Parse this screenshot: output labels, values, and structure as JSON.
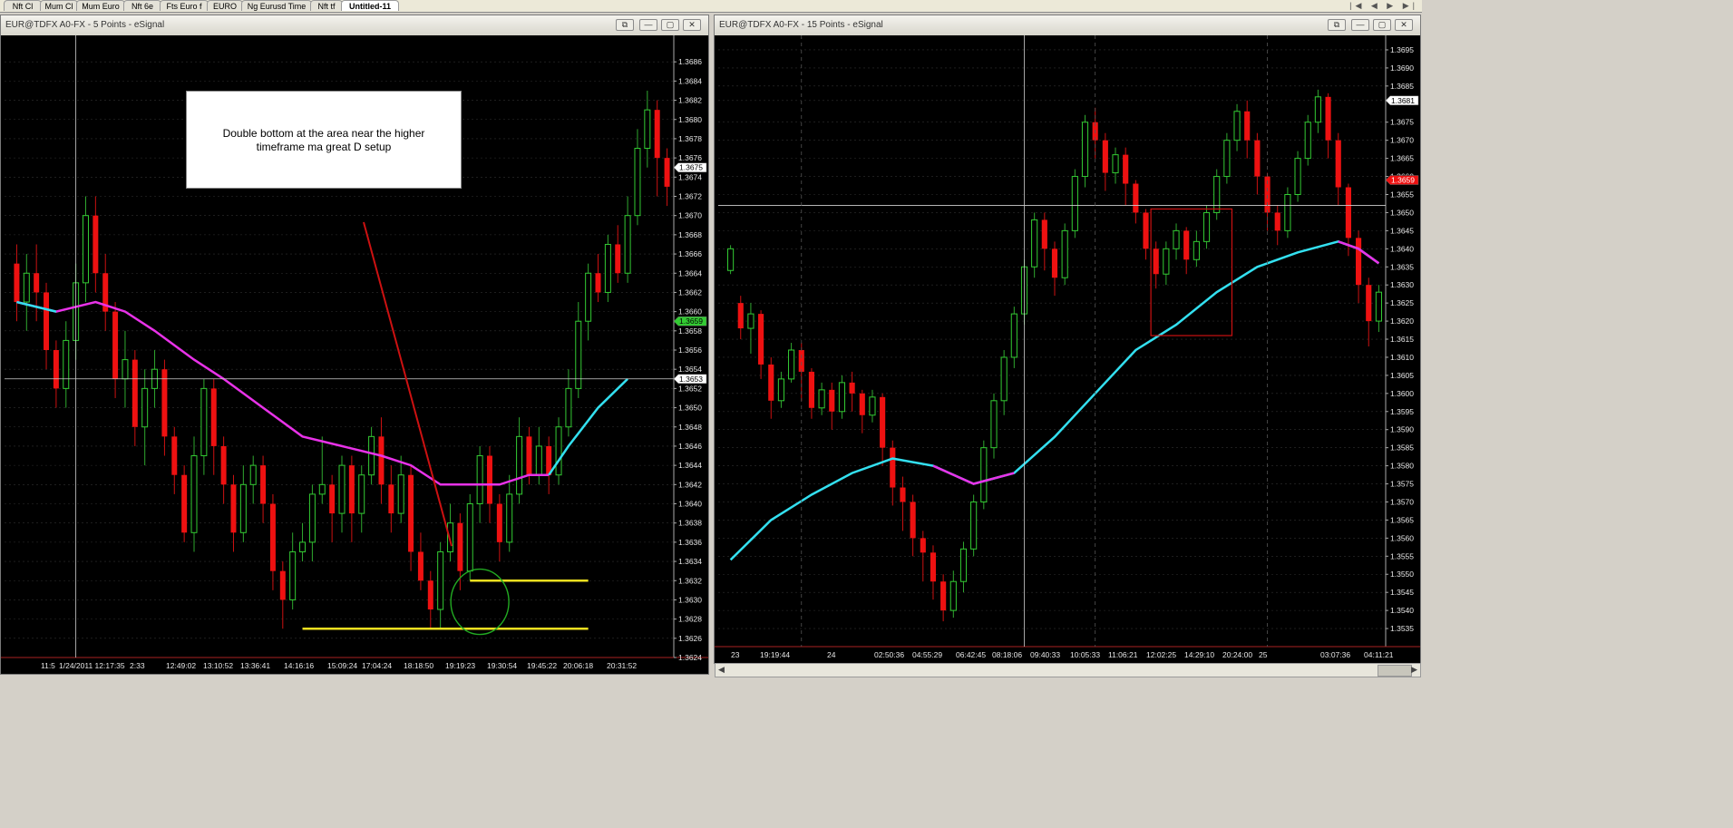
{
  "tabs": [
    {
      "label": "Nft Cl",
      "active": false
    },
    {
      "label": "Mum Cl",
      "active": false
    },
    {
      "label": "Mum Euro",
      "active": false
    },
    {
      "label": "Nft 6e",
      "active": false
    },
    {
      "label": "Fts Euro f",
      "active": false
    },
    {
      "label": "EURO",
      "active": false
    },
    {
      "label": "Ng Eurusd Time",
      "active": false
    },
    {
      "label": "Nft tf",
      "active": false
    },
    {
      "label": "Untitled-11",
      "active": true
    }
  ],
  "nav_arrows": "|◀ ◀ ▶ ▶|",
  "left_window": {
    "title": "EUR@TDFX A0-FX - 5 Points - eSignal",
    "note": "Double bottom at the area near the higher timeframe ma great D setup"
  },
  "right_window": {
    "title": "EUR@TDFX A0-FX - 15 Points - eSignal"
  },
  "chart_data": [
    {
      "type": "candlestick",
      "interval": "5 Points",
      "ylim": [
        1.3624,
        1.3688
      ],
      "y_ticks": [
        "1.3686",
        "1.3684",
        "1.3682",
        "1.3680",
        "1.3678",
        "1.3676",
        "1.3674",
        "1.3672",
        "1.3670",
        "1.3668",
        "1.3666",
        "1.3664",
        "1.3662",
        "1.3660",
        "1.3658",
        "1.3656",
        "1.3654",
        "1.3652",
        "1.3650",
        "1.3648",
        "1.3646",
        "1.3644",
        "1.3642",
        "1.3640",
        "1.3638",
        "1.3636",
        "1.3634",
        "1.3632",
        "1.3630",
        "1.3628",
        "1.3626",
        "1.3624"
      ],
      "x_ticks": [
        "11:5",
        "1/24/2011 12:17:35",
        "2:33",
        "12:49:02",
        "13:10:52",
        "13:36:41",
        "14:16:16",
        "15:09:24",
        "17:04:24",
        "18:18:50",
        "19:19:23",
        "19:30:54",
        "19:45:22",
        "20:06:18",
        "20:31:52"
      ],
      "price_labels": [
        {
          "text": "1.3675",
          "value": 1.3675,
          "bg": "#ffffff",
          "fg": "#000000"
        },
        {
          "text": "1.3659",
          "value": 1.3659,
          "bg": "#33cc33",
          "fg": "#000000"
        },
        {
          "text": "1.3653",
          "value": 1.3653,
          "bg": "#ffffff",
          "fg": "#000000"
        }
      ],
      "crosshair": {
        "price": 1.3653
      },
      "support_lines": [
        1.3632,
        1.3627
      ],
      "ma_colors": {
        "above": "#e832e8",
        "below": "#33e0f0"
      },
      "colors": {
        "up": "#33cc33",
        "down": "#ee1111",
        "neutral": "#c8c8c8"
      },
      "candles": [
        [
          1.3665,
          1.3661,
          1.3667,
          1.3659
        ],
        [
          1.3661,
          1.3664,
          1.3666,
          1.3658
        ],
        [
          1.3664,
          1.3662,
          1.3667,
          1.3659
        ],
        [
          1.3662,
          1.3656,
          1.3663,
          1.3654
        ],
        [
          1.3656,
          1.3652,
          1.3657,
          1.365
        ],
        [
          1.3652,
          1.3657,
          1.3659,
          1.365
        ],
        [
          1.3657,
          1.3663,
          1.3665,
          1.3655
        ],
        [
          1.3663,
          1.367,
          1.3672,
          1.3661
        ],
        [
          1.367,
          1.3664,
          1.3672,
          1.3662
        ],
        [
          1.3664,
          1.366,
          1.3666,
          1.3658
        ],
        [
          1.366,
          1.3653,
          1.3661,
          1.3651
        ],
        [
          1.3653,
          1.3655,
          1.3658,
          1.365
        ],
        [
          1.3655,
          1.3648,
          1.3656,
          1.3646
        ],
        [
          1.3648,
          1.3652,
          1.3654,
          1.3644
        ],
        [
          1.3652,
          1.3654,
          1.3656,
          1.365
        ],
        [
          1.3654,
          1.3647,
          1.3655,
          1.3645
        ],
        [
          1.3647,
          1.3643,
          1.3648,
          1.3641
        ],
        [
          1.3643,
          1.3637,
          1.3644,
          1.3636
        ],
        [
          1.3637,
          1.3645,
          1.3647,
          1.3635
        ],
        [
          1.3645,
          1.3652,
          1.3653,
          1.3643
        ],
        [
          1.3652,
          1.3646,
          1.3653,
          1.3643
        ],
        [
          1.3646,
          1.3642,
          1.3647,
          1.364
        ],
        [
          1.3642,
          1.3637,
          1.3643,
          1.3635
        ],
        [
          1.3637,
          1.3642,
          1.3644,
          1.3636
        ],
        [
          1.3642,
          1.3644,
          1.3645,
          1.364
        ],
        [
          1.3644,
          1.364,
          1.3645,
          1.3638
        ],
        [
          1.364,
          1.3633,
          1.3641,
          1.3631
        ],
        [
          1.3633,
          1.363,
          1.3634,
          1.3627
        ],
        [
          1.363,
          1.3635,
          1.3637,
          1.3629
        ],
        [
          1.3635,
          1.3636,
          1.3638,
          1.3634
        ],
        [
          1.3636,
          1.3641,
          1.3642,
          1.3634
        ],
        [
          1.3641,
          1.3642,
          1.3647,
          1.364
        ],
        [
          1.3642,
          1.3639,
          1.3643,
          1.3636
        ],
        [
          1.3639,
          1.3644,
          1.3645,
          1.3637
        ],
        [
          1.3644,
          1.3639,
          1.3645,
          1.3636
        ],
        [
          1.3639,
          1.3643,
          1.3644,
          1.3637
        ],
        [
          1.3643,
          1.3647,
          1.3648,
          1.3642
        ],
        [
          1.3647,
          1.3642,
          1.3649,
          1.364
        ],
        [
          1.3642,
          1.3639,
          1.3644,
          1.3637
        ],
        [
          1.3639,
          1.3643,
          1.3645,
          1.3638
        ],
        [
          1.3643,
          1.3635,
          1.3644,
          1.3633
        ],
        [
          1.3635,
          1.3632,
          1.3637,
          1.3631
        ],
        [
          1.3632,
          1.3629,
          1.3633,
          1.3627
        ],
        [
          1.3629,
          1.3635,
          1.3636,
          1.3627
        ],
        [
          1.3635,
          1.3638,
          1.364,
          1.3634
        ],
        [
          1.3638,
          1.3633,
          1.3639,
          1.3631
        ],
        [
          1.3633,
          1.364,
          1.3641,
          1.3632
        ],
        [
          1.364,
          1.3645,
          1.3646,
          1.3638
        ],
        [
          1.3645,
          1.364,
          1.3646,
          1.3638
        ],
        [
          1.364,
          1.3636,
          1.3641,
          1.3634
        ],
        [
          1.3636,
          1.3641,
          1.3643,
          1.3635
        ],
        [
          1.3641,
          1.3647,
          1.3649,
          1.364
        ],
        [
          1.3647,
          1.3643,
          1.3648,
          1.3642
        ],
        [
          1.3643,
          1.3646,
          1.3648,
          1.3642
        ],
        [
          1.3646,
          1.3643,
          1.3647,
          1.3641
        ],
        [
          1.3643,
          1.3648,
          1.3649,
          1.3642
        ],
        [
          1.3648,
          1.3652,
          1.3654,
          1.3647
        ],
        [
          1.3652,
          1.3659,
          1.3661,
          1.3651
        ],
        [
          1.3659,
          1.3664,
          1.3665,
          1.3657
        ],
        [
          1.3664,
          1.3662,
          1.3666,
          1.3661
        ],
        [
          1.3662,
          1.3667,
          1.3668,
          1.3661
        ],
        [
          1.3667,
          1.3664,
          1.3669,
          1.3663
        ],
        [
          1.3664,
          1.367,
          1.3672,
          1.3663
        ],
        [
          1.367,
          1.3677,
          1.3679,
          1.3669
        ],
        [
          1.3677,
          1.3681,
          1.3683,
          1.3675
        ],
        [
          1.3681,
          1.3676,
          1.3682,
          1.3672
        ],
        [
          1.3676,
          1.3673,
          1.3677,
          1.3671
        ]
      ],
      "ma": [
        [
          0,
          1.3661
        ],
        [
          4,
          1.366
        ],
        [
          8,
          1.3661
        ],
        [
          11,
          1.366
        ],
        [
          14,
          1.3658
        ],
        [
          18,
          1.3655
        ],
        [
          21,
          1.3653
        ],
        [
          25,
          1.365
        ],
        [
          29,
          1.3647
        ],
        [
          33,
          1.3646
        ],
        [
          37,
          1.3645
        ],
        [
          40,
          1.3644
        ],
        [
          43,
          1.3642
        ],
        [
          46,
          1.3642
        ],
        [
          49,
          1.3642
        ],
        [
          52,
          1.3643
        ],
        [
          54,
          1.3643
        ],
        [
          56,
          1.3646
        ],
        [
          59,
          1.365
        ],
        [
          62,
          1.3653
        ]
      ],
      "ma_switch_index": 53
    },
    {
      "type": "candlestick",
      "interval": "15 Points",
      "ylim": [
        1.353,
        1.3697
      ],
      "y_ticks": [
        "1.3695",
        "1.3690",
        "1.3685",
        "1.3681",
        "1.3675",
        "1.3670",
        "1.3665",
        "1.3660",
        "1.3655",
        "1.3650",
        "1.3645",
        "1.3640",
        "1.3635",
        "1.3630",
        "1.3625",
        "1.3620",
        "1.3615",
        "1.3610",
        "1.3605",
        "1.3600",
        "1.3595",
        "1.3590",
        "1.3585",
        "1.3580",
        "1.3575",
        "1.3570",
        "1.3565",
        "1.3560",
        "1.3555",
        "1.3550",
        "1.3545",
        "1.3540",
        "1.3535"
      ],
      "x_ticks": [
        "23",
        "19:19:44",
        "24",
        "02:50:36",
        "04:55:29",
        "06:42:45",
        "08:18:06",
        "09:40:33",
        "10:05:33",
        "11:06:21",
        "12:02:25",
        "14:29:10",
        "20:24:00",
        "25",
        "03:07:36",
        "04:11:21"
      ],
      "price_labels": [
        {
          "text": "1.3681",
          "value": 1.3681,
          "bg": "#ffffff",
          "fg": "#000000"
        },
        {
          "text": "1.3659",
          "value": 1.3659,
          "bg": "#ee1111",
          "fg": "#ffffff"
        }
      ],
      "crosshair": {
        "price": 1.3652
      },
      "highlight_box": {
        "x0": 42,
        "x1": 49,
        "y_top": 1.3651,
        "y_bottom": 1.3616
      },
      "ma_colors": {
        "above": "#e832e8",
        "below": "#33e0f0"
      },
      "colors": {
        "up": "#33cc33",
        "down": "#ee1111",
        "neutral": "#c8c8c8"
      },
      "candles": [
        [
          1.3634,
          1.364,
          1.3641,
          1.3633
        ],
        [
          1.3625,
          1.3618,
          1.3627,
          1.3615
        ],
        [
          1.3618,
          1.3622,
          1.3625,
          1.3611
        ],
        [
          1.3622,
          1.3608,
          1.3623,
          1.3604
        ],
        [
          1.3608,
          1.3598,
          1.361,
          1.3593
        ],
        [
          1.3598,
          1.3604,
          1.3606,
          1.3596
        ],
        [
          1.3604,
          1.3612,
          1.3614,
          1.3603
        ],
        [
          1.3612,
          1.3606,
          1.3614,
          1.3598
        ],
        [
          1.3606,
          1.3596,
          1.3607,
          1.3593
        ],
        [
          1.3596,
          1.3601,
          1.3603,
          1.3594
        ],
        [
          1.3601,
          1.3595,
          1.3603,
          1.359
        ],
        [
          1.3595,
          1.3603,
          1.3605,
          1.3593
        ],
        [
          1.3603,
          1.36,
          1.3606,
          1.3595
        ],
        [
          1.36,
          1.3594,
          1.3601,
          1.3589
        ],
        [
          1.3594,
          1.3599,
          1.3601,
          1.3592
        ],
        [
          1.3599,
          1.3585,
          1.36,
          1.358
        ],
        [
          1.3585,
          1.3574,
          1.3587,
          1.3569
        ],
        [
          1.3574,
          1.357,
          1.3577,
          1.3562
        ],
        [
          1.357,
          1.356,
          1.3572,
          1.3555
        ],
        [
          1.356,
          1.3556,
          1.3562,
          1.3548
        ],
        [
          1.3556,
          1.3548,
          1.3558,
          1.3543
        ],
        [
          1.3548,
          1.354,
          1.355,
          1.3537
        ],
        [
          1.354,
          1.3548,
          1.3551,
          1.3538
        ],
        [
          1.3548,
          1.3557,
          1.3559,
          1.3545
        ],
        [
          1.3557,
          1.357,
          1.3572,
          1.3555
        ],
        [
          1.357,
          1.3585,
          1.3587,
          1.3568
        ],
        [
          1.3585,
          1.3598,
          1.36,
          1.3582
        ],
        [
          1.3598,
          1.361,
          1.3612,
          1.3594
        ],
        [
          1.361,
          1.3622,
          1.3624,
          1.3607
        ],
        [
          1.3622,
          1.3635,
          1.3637,
          1.3619
        ],
        [
          1.3635,
          1.3648,
          1.365,
          1.3632
        ],
        [
          1.3648,
          1.364,
          1.365,
          1.3634
        ],
        [
          1.364,
          1.3632,
          1.3642,
          1.3627
        ],
        [
          1.3632,
          1.3645,
          1.3647,
          1.363
        ],
        [
          1.3645,
          1.366,
          1.3662,
          1.3643
        ],
        [
          1.366,
          1.3675,
          1.3677,
          1.3657
        ],
        [
          1.3675,
          1.367,
          1.3679,
          1.3665
        ],
        [
          1.367,
          1.3661,
          1.3672,
          1.3656
        ],
        [
          1.3661,
          1.3666,
          1.3668,
          1.3658
        ],
        [
          1.3666,
          1.3658,
          1.3668,
          1.3652
        ],
        [
          1.3658,
          1.365,
          1.3659,
          1.3647
        ],
        [
          1.365,
          1.364,
          1.3651,
          1.3637
        ],
        [
          1.364,
          1.3633,
          1.3642,
          1.3629
        ],
        [
          1.3633,
          1.364,
          1.3642,
          1.363
        ],
        [
          1.364,
          1.3645,
          1.3647,
          1.3637
        ],
        [
          1.3645,
          1.3637,
          1.3646,
          1.3633
        ],
        [
          1.3637,
          1.3642,
          1.3645,
          1.3635
        ],
        [
          1.3642,
          1.365,
          1.3652,
          1.364
        ],
        [
          1.365,
          1.366,
          1.3662,
          1.3648
        ],
        [
          1.366,
          1.367,
          1.3672,
          1.3658
        ],
        [
          1.367,
          1.3678,
          1.368,
          1.3667
        ],
        [
          1.3678,
          1.367,
          1.3681,
          1.3665
        ],
        [
          1.367,
          1.366,
          1.3672,
          1.3655
        ],
        [
          1.366,
          1.365,
          1.3661,
          1.3645
        ],
        [
          1.365,
          1.3645,
          1.3652,
          1.3641
        ],
        [
          1.3645,
          1.3655,
          1.3657,
          1.3643
        ],
        [
          1.3655,
          1.3665,
          1.3667,
          1.3653
        ],
        [
          1.3665,
          1.3675,
          1.3677,
          1.3663
        ],
        [
          1.3675,
          1.3682,
          1.3684,
          1.3672
        ],
        [
          1.3682,
          1.367,
          1.3683,
          1.3665
        ],
        [
          1.367,
          1.3657,
          1.3672,
          1.3652
        ],
        [
          1.3657,
          1.3643,
          1.3658,
          1.3638
        ],
        [
          1.3643,
          1.363,
          1.3645,
          1.3625
        ],
        [
          1.363,
          1.362,
          1.3632,
          1.3613
        ],
        [
          1.362,
          1.3628,
          1.363,
          1.3617
        ]
      ],
      "ma": [
        [
          0,
          1.3554
        ],
        [
          4,
          1.3565
        ],
        [
          8,
          1.3572
        ],
        [
          12,
          1.3578
        ],
        [
          16,
          1.3582
        ],
        [
          20,
          1.358
        ],
        [
          24,
          1.3575
        ],
        [
          28,
          1.3578
        ],
        [
          32,
          1.3588
        ],
        [
          36,
          1.36
        ],
        [
          40,
          1.3612
        ],
        [
          44,
          1.3619
        ],
        [
          48,
          1.3628
        ],
        [
          52,
          1.3635
        ],
        [
          56,
          1.3639
        ],
        [
          60,
          1.3642
        ],
        [
          62,
          1.364
        ],
        [
          64,
          1.3636
        ]
      ],
      "ma_switch_index": [
        [
          17,
          27
        ],
        [
          60,
          64
        ]
      ]
    }
  ]
}
